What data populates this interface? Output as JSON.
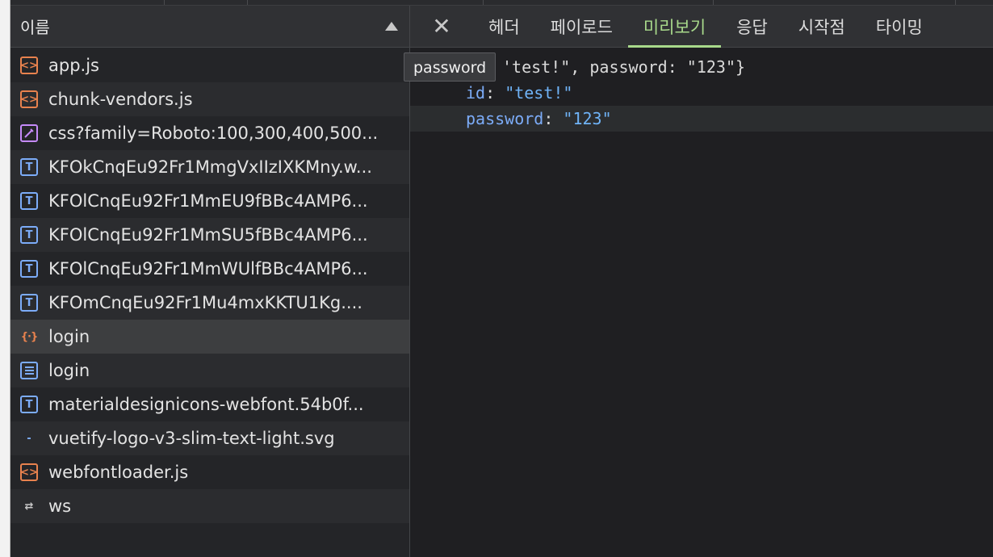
{
  "request_list": {
    "header_label": "이름",
    "rows": [
      {
        "icon": "script-icon",
        "name": "app.js"
      },
      {
        "icon": "script-icon",
        "name": "chunk-vendors.js"
      },
      {
        "icon": "stylesheet-icon",
        "name": "css?family=Roboto:100,300,400,500..."
      },
      {
        "icon": "font-icon",
        "name": "KFOkCnqEu92Fr1MmgVxIIzIXKMny.w..."
      },
      {
        "icon": "font-icon",
        "name": "KFOlCnqEu92Fr1MmEU9fBBc4AMP6..."
      },
      {
        "icon": "font-icon",
        "name": "KFOlCnqEu92Fr1MmSU5fBBc4AMP6..."
      },
      {
        "icon": "font-icon",
        "name": "KFOlCnqEu92Fr1MmWUlfBBc4AMP6..."
      },
      {
        "icon": "font-icon",
        "name": "KFOmCnqEu92Fr1Mu4mxKKTU1Kg...."
      },
      {
        "icon": "fetch-icon",
        "name": "login",
        "selected": true
      },
      {
        "icon": "document-icon",
        "name": "login"
      },
      {
        "icon": "font-icon",
        "name": "materialdesignicons-webfont.54b0f..."
      },
      {
        "icon": "svg-image-icon",
        "name": "vuetify-logo-v3-slim-text-light.svg"
      },
      {
        "icon": "script-icon",
        "name": "webfontloader.js"
      },
      {
        "icon": "websocket-icon",
        "name": "ws"
      }
    ]
  },
  "detail": {
    "close_glyph": "✕",
    "tabs": [
      {
        "label": "헤더"
      },
      {
        "label": "페이로드"
      },
      {
        "label": "미리보기",
        "active": true
      },
      {
        "label": "응답"
      },
      {
        "label": "시작점"
      },
      {
        "label": "타이밍"
      }
    ],
    "preview": {
      "summary": "'test!\", password: \"123\"}",
      "properties": [
        {
          "key": "id",
          "value": "\"test!\""
        },
        {
          "key": "password",
          "value": "\"123\"",
          "highlighted": true
        }
      ]
    }
  },
  "tooltip": {
    "text": "password"
  },
  "colors": {
    "accent_active_tab": "#a8d98b",
    "script_icon": "#e8824e",
    "font_icon": "#7cacf8",
    "stylesheet_icon": "#c58af9",
    "json_key": "#7cacf8",
    "json_string": "#6fb3f7"
  }
}
